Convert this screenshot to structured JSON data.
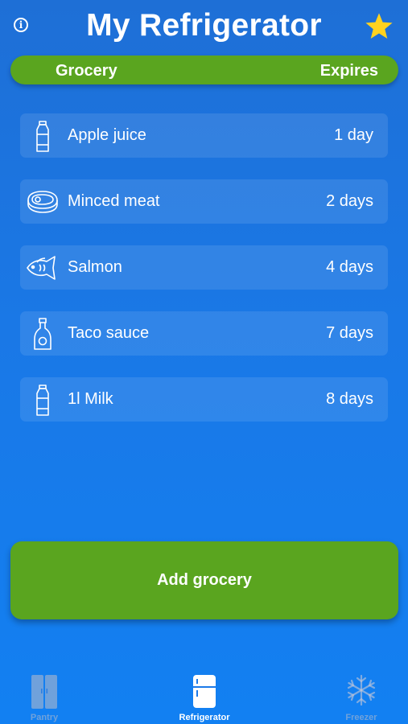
{
  "header": {
    "title": "My Refrigerator",
    "info_icon": "info-icon",
    "star_icon": "star-icon"
  },
  "columns": {
    "left": "Grocery",
    "right": "Expires"
  },
  "items": [
    {
      "name": "Apple juice",
      "expires": "1 day",
      "icon": "bottle-icon"
    },
    {
      "name": "Minced meat",
      "expires": "2 days",
      "icon": "meat-icon"
    },
    {
      "name": "Salmon",
      "expires": "4 days",
      "icon": "fish-icon"
    },
    {
      "name": "Taco sauce",
      "expires": "7 days",
      "icon": "sauce-bottle-icon"
    },
    {
      "name": "1l Milk",
      "expires": "8 days",
      "icon": "bottle-icon"
    }
  ],
  "add_button": {
    "label": "Add grocery"
  },
  "tabs": [
    {
      "label": "Pantry",
      "icon": "pantry-icon",
      "active": false
    },
    {
      "label": "Refrigerator",
      "icon": "refrigerator-icon",
      "active": true
    },
    {
      "label": "Freezer",
      "icon": "snowflake-icon",
      "active": false
    }
  ],
  "colors": {
    "background_top": "#1e6fd6",
    "background_bottom": "#1280f2",
    "accent_green": "#5aa51f",
    "star": "#ffd21f"
  }
}
